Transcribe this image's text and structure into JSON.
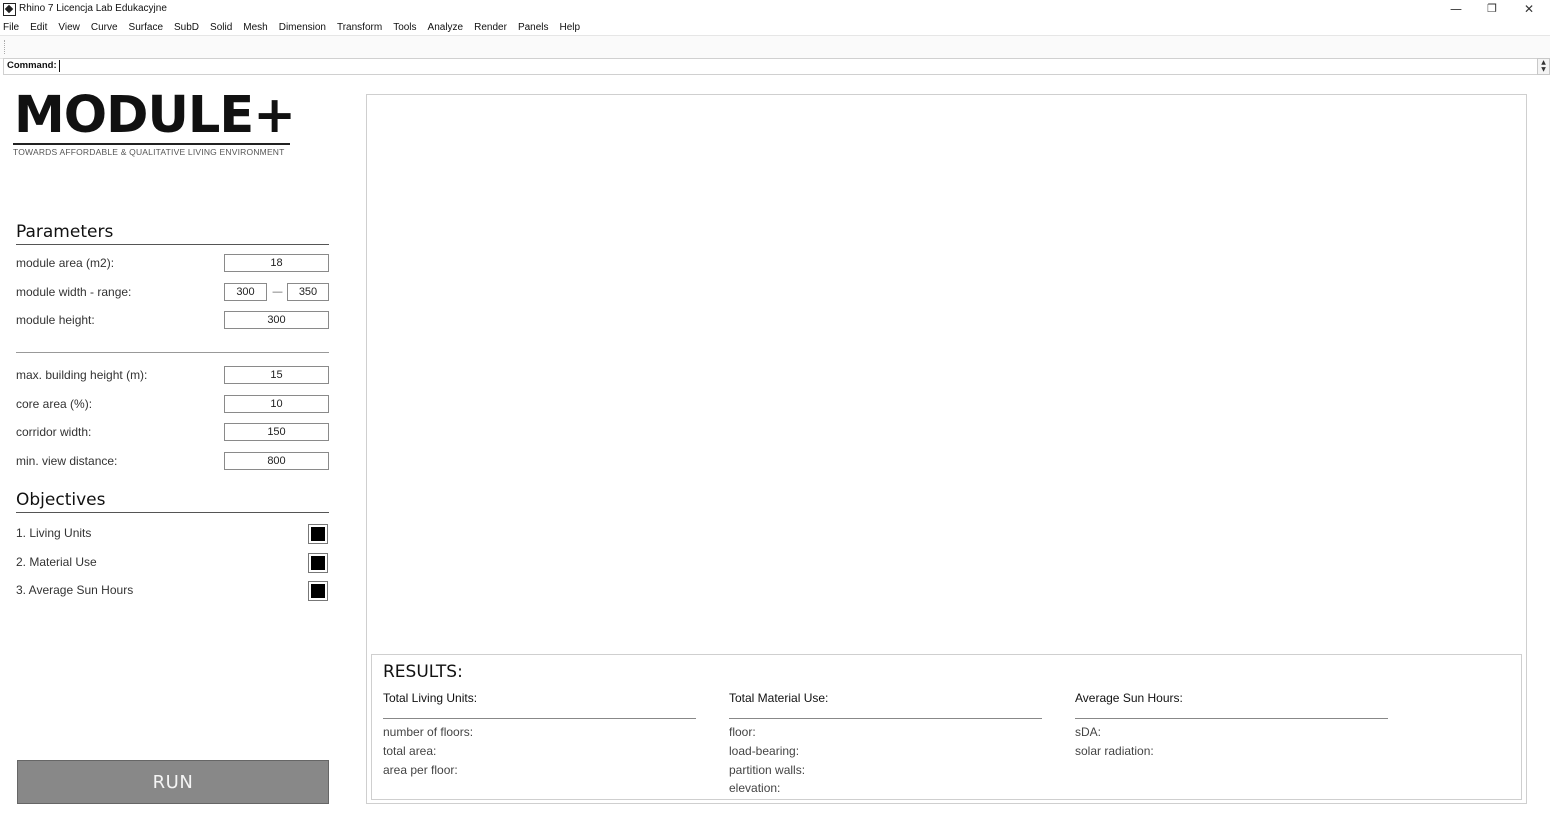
{
  "window": {
    "title": "Rhino 7 Licencja Lab Edukacyjne",
    "minimize_glyph": "—",
    "maximize_glyph": "❐",
    "close_glyph": "✕"
  },
  "menu": [
    "File",
    "Edit",
    "View",
    "Curve",
    "Surface",
    "SubD",
    "Solid",
    "Mesh",
    "Dimension",
    "Transform",
    "Tools",
    "Analyze",
    "Render",
    "Panels",
    "Help"
  ],
  "command": {
    "label": "Command:",
    "value": ""
  },
  "brand": {
    "logo": "MODULE+",
    "tagline": "TOWARDS AFFORDABLE & QUALITATIVE LIVING ENVIRONMENT"
  },
  "parameters": {
    "title": "Parameters",
    "module_area": {
      "label": "module area (m2):",
      "value": "18"
    },
    "module_width": {
      "label": "module width - range:",
      "min": "300",
      "separator": "—",
      "max": "350"
    },
    "module_height": {
      "label": "module height:",
      "value": "300"
    },
    "max_building_height": {
      "label": "max. building height (m):",
      "value": "15"
    },
    "core_area": {
      "label": "core area (%):",
      "value": "10"
    },
    "corridor_width": {
      "label": "corridor width:",
      "value": "150"
    },
    "min_view_distance": {
      "label": "min. view distance:",
      "value": "800"
    }
  },
  "objectives": {
    "title": "Objectives",
    "items": [
      {
        "label": "1. Living Units",
        "checked": true
      },
      {
        "label": "2. Material Use",
        "checked": true
      },
      {
        "label": "3. Average Sun Hours",
        "checked": true
      }
    ]
  },
  "run_label": "RUN",
  "results": {
    "title": "RESULTS:",
    "living_units": {
      "heading": "Total Living Units:",
      "items": [
        "number of floors:",
        "total area:",
        "area per floor:"
      ]
    },
    "material_use": {
      "heading": "Total Material Use:",
      "items": [
        "floor:",
        "load-bearing:",
        "partition walls:",
        "elevation:"
      ]
    },
    "sun_hours": {
      "heading": "Average Sun Hours:",
      "items": [
        "sDA:",
        "solar radiation:"
      ]
    }
  },
  "colors": {
    "run_button": "#888888",
    "checkbox_fill": "#000000",
    "background": "#ffffff"
  }
}
